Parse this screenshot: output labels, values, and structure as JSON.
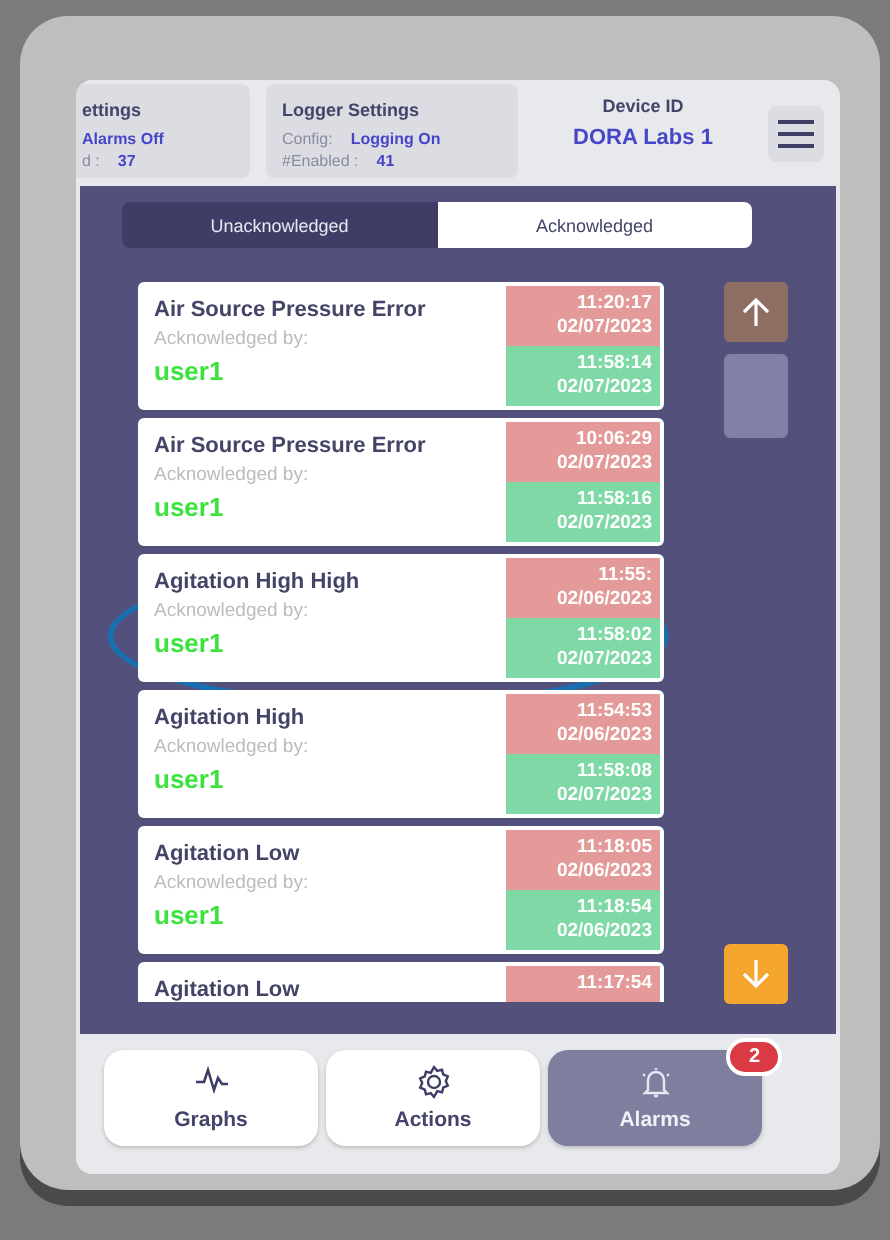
{
  "header": {
    "panels": [
      {
        "title": "ettings",
        "rows": [
          {
            "label": "",
            "value": "Alarms Off"
          },
          {
            "label": "d :",
            "value": "37"
          }
        ]
      },
      {
        "title": "Logger Settings",
        "rows": [
          {
            "label": "Config:",
            "value": "Logging On"
          },
          {
            "label": "#Enabled :",
            "value": "41"
          }
        ]
      }
    ],
    "device": {
      "label": "Device ID",
      "value": "DORA Labs 1"
    }
  },
  "tabs": [
    {
      "label": "Unacknowledged",
      "selected": false
    },
    {
      "label": "Acknowledged",
      "selected": true
    }
  ],
  "alarms": [
    {
      "name": "Air Source Pressure Error",
      "ack_label": "Acknowledged by:",
      "user": "user1",
      "raised_time": "11:20:17",
      "raised_date": "02/07/2023",
      "ack_time": "11:58:14",
      "ack_date": "02/07/2023"
    },
    {
      "name": "Air Source Pressure Error",
      "ack_label": "Acknowledged by:",
      "user": "user1",
      "raised_time": "10:06:29",
      "raised_date": "02/07/2023",
      "ack_time": "11:58:16",
      "ack_date": "02/07/2023"
    },
    {
      "name": "Agitation High High",
      "ack_label": "Acknowledged by:",
      "user": "user1",
      "raised_time": "11:55:",
      "raised_date": "02/06/2023",
      "ack_time": "11:58:02",
      "ack_date": "02/07/2023"
    },
    {
      "name": "Agitation High",
      "ack_label": "Acknowledged by:",
      "user": "user1",
      "raised_time": "11:54:53",
      "raised_date": "02/06/2023",
      "ack_time": "11:58:08",
      "ack_date": "02/07/2023"
    },
    {
      "name": "Agitation Low",
      "ack_label": "Acknowledged by:",
      "user": "user1",
      "raised_time": "11:18:05",
      "raised_date": "02/06/2023",
      "ack_time": "11:18:54",
      "ack_date": "02/06/2023"
    },
    {
      "name": "Agitation Low",
      "raised_time": "11:17:54"
    }
  ],
  "scroll": {
    "up_disabled": true,
    "down_disabled": false
  },
  "nav": [
    {
      "label": "Graphs",
      "selected": false
    },
    {
      "label": "Actions",
      "selected": false
    },
    {
      "label": "Alarms",
      "selected": true,
      "badge": "2"
    }
  ]
}
